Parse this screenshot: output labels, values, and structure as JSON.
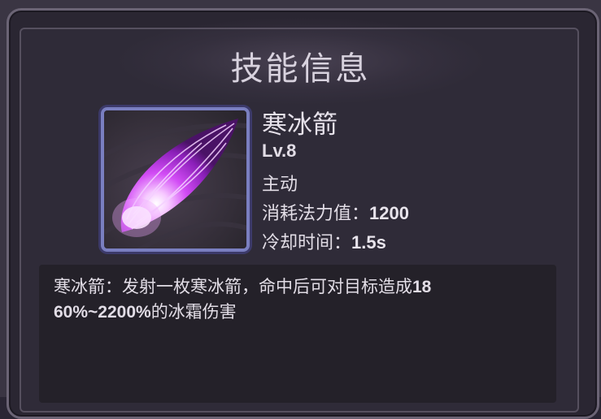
{
  "panel": {
    "title": "技能信息"
  },
  "skill": {
    "icon": "purple-ice-arrow-icon",
    "name": "寒冰箭",
    "level": "Lv.8",
    "type": "主动",
    "mana_cost_label": "消耗法力值：",
    "mana_cost_value": "1200",
    "cooldown_label": "冷却时间：",
    "cooldown_value": "1.5s"
  },
  "description": {
    "prefix": "寒冰箭：发射一枚寒冰箭，命中后可对目标造成",
    "line1_number": "18",
    "line2_number": "60%~2200%",
    "suffix": "的冰霜伤害"
  },
  "colors": {
    "accent_purple": "#c03cf0",
    "icon_border": "#7a7fc0",
    "text": "#e2dde6"
  }
}
